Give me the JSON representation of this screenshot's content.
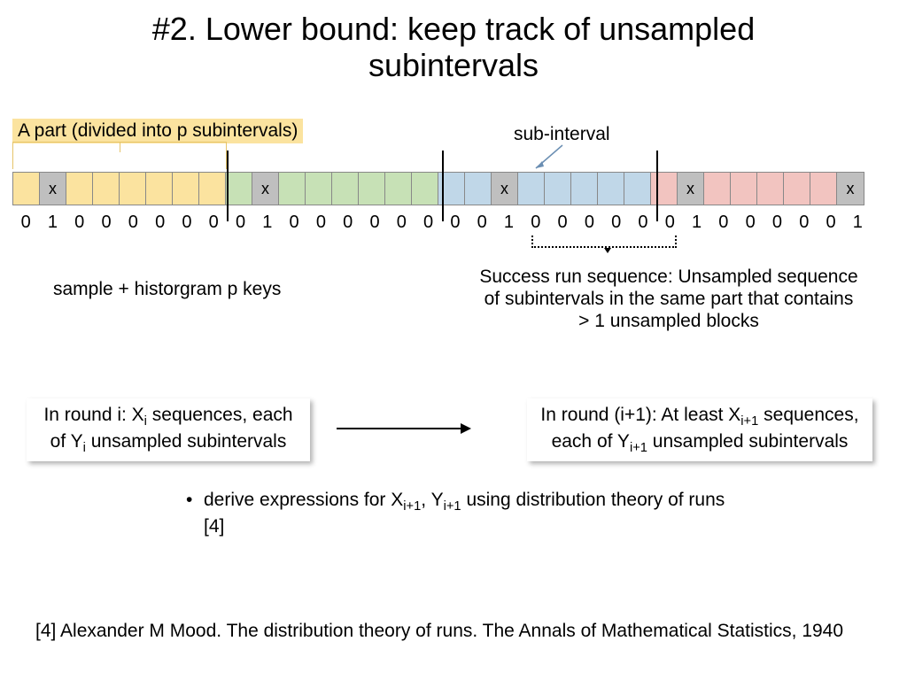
{
  "title_line1": "#2. Lower bound: keep track of unsampled",
  "title_line2": "subintervals",
  "part_label": "A part (divided into p subintervals)",
  "sub_interval_label": "sub-interval",
  "cells": [
    {
      "x": false,
      "color": "yellow"
    },
    {
      "x": true,
      "color": "gray"
    },
    {
      "x": false,
      "color": "yellow"
    },
    {
      "x": false,
      "color": "yellow"
    },
    {
      "x": false,
      "color": "yellow"
    },
    {
      "x": false,
      "color": "yellow"
    },
    {
      "x": false,
      "color": "yellow"
    },
    {
      "x": false,
      "color": "yellow"
    },
    {
      "x": false,
      "color": "green"
    },
    {
      "x": true,
      "color": "gray"
    },
    {
      "x": false,
      "color": "green"
    },
    {
      "x": false,
      "color": "green"
    },
    {
      "x": false,
      "color": "green"
    },
    {
      "x": false,
      "color": "green"
    },
    {
      "x": false,
      "color": "green"
    },
    {
      "x": false,
      "color": "green"
    },
    {
      "x": false,
      "color": "blue"
    },
    {
      "x": false,
      "color": "blue"
    },
    {
      "x": true,
      "color": "gray"
    },
    {
      "x": false,
      "color": "blue"
    },
    {
      "x": false,
      "color": "blue"
    },
    {
      "x": false,
      "color": "blue"
    },
    {
      "x": false,
      "color": "blue"
    },
    {
      "x": false,
      "color": "blue"
    },
    {
      "x": false,
      "color": "red"
    },
    {
      "x": true,
      "color": "gray"
    },
    {
      "x": false,
      "color": "red"
    },
    {
      "x": false,
      "color": "red"
    },
    {
      "x": false,
      "color": "red"
    },
    {
      "x": false,
      "color": "red"
    },
    {
      "x": false,
      "color": "red"
    },
    {
      "x": true,
      "color": "gray"
    }
  ],
  "bits": [
    "0",
    "1",
    "0",
    "0",
    "0",
    "0",
    "0",
    "0",
    "0",
    "1",
    "0",
    "0",
    "0",
    "0",
    "0",
    "0",
    "0",
    "0",
    "1",
    "0",
    "0",
    "0",
    "0",
    "0",
    "0",
    "1",
    "0",
    "0",
    "0",
    "0",
    "0",
    "1"
  ],
  "x_mark": "x",
  "sample_text": "sample + historgram p keys",
  "success_text": "Success run sequence: Unsampled sequence of  subintervals in the same part that contains > 1 unsampled blocks",
  "box_left": {
    "pre": "In round i:  X",
    "s1": "i",
    "mid": " sequences, each of  Y",
    "s2": "i",
    "post": " unsampled subintervals"
  },
  "box_right": {
    "pre": "In round (i+1): At least X",
    "s1": "i+1",
    "mid": " sequences, each of  Y",
    "s2": "i+1",
    "post": " unsampled subintervals"
  },
  "bullet": {
    "pre": "derive expressions for X",
    "s1": "i+1",
    "mid": ", Y",
    "s2": "i+1",
    "post": " using distribution theory of runs [4]"
  },
  "citation": "[4] Alexander M Mood. The distribution theory of runs.  The Annals of Mathematical Statistics, 1940"
}
